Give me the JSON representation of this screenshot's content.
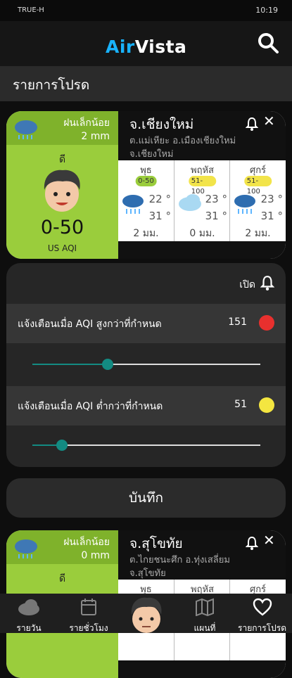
{
  "status_bar": {
    "carrier": "TRUE-H",
    "time": "10:19"
  },
  "app": {
    "logo_part1": "Air",
    "logo_part2": "Vista"
  },
  "section": {
    "title": "รายการโปรด"
  },
  "cards": [
    {
      "rain_title": "ฝนเล็กน้อย",
      "rain_amount": "2 mm",
      "level": "ดี",
      "aqi": "0-50",
      "aqi_unit": "US AQI",
      "place": "จ.เชียงใหม่",
      "district": "ต.แม่เหียะ อ.เมืองเชียงใหม่ จ.เชียงใหม่",
      "forecast": [
        {
          "day": "พุธ",
          "badge": "0-50",
          "badge_color": "#9acd3c",
          "hi": "22 °",
          "lo": "31 °",
          "rain": "2 มม.",
          "icon": "rain-cloud-icon"
        },
        {
          "day": "พฤหัส",
          "badge": "51-100",
          "badge_color": "#f2e44a",
          "hi": "23 °",
          "lo": "31 °",
          "rain": "0 มม.",
          "icon": "cloud-icon"
        },
        {
          "day": "ศุกร์",
          "badge": "51-100",
          "badge_color": "#f2e44a",
          "hi": "23 °",
          "lo": "31 °",
          "rain": "2 มม.",
          "icon": "rain-cloud-icon"
        }
      ]
    },
    {
      "rain_title": "ฝนเล็กน้อย",
      "rain_amount": "0 mm",
      "level": "ดี",
      "place": "จ.สุโขทัย",
      "district": "ต.ไกยชนะศึก อ.ทุ่งเสลี่ยม จ.สุโขทัย",
      "forecast_days": [
        "พุธ",
        "พฤหัส",
        "ศุกร์"
      ]
    }
  ],
  "alert_panel": {
    "on_label": "เปิด",
    "high_label": "แจ้งเตือนเมื่อ AQI สูงกว่าที่กำหนด",
    "high_value": "151",
    "high_color": "#e8302e",
    "high_level": 0.33,
    "low_label": "แจ้งเตือนเมื่อ AQI ต่ำกว่าที่กำหนด",
    "low_value": "51",
    "low_color": "#f4e640",
    "low_level": 0.13
  },
  "save_label": "บันทึก",
  "tabs": [
    {
      "label": "รายวัน",
      "icon": "cloud-icon"
    },
    {
      "label": "รายชั่วโมง",
      "icon": "calendar-icon"
    },
    {
      "label": "แผนที่",
      "icon": "map-icon"
    },
    {
      "label": "รายการโปรด",
      "icon": "heart-icon"
    }
  ],
  "colors": {
    "good_green": "#9acd3c",
    "accent_teal": "#138b82",
    "logo_blue": "#19b3ff"
  }
}
